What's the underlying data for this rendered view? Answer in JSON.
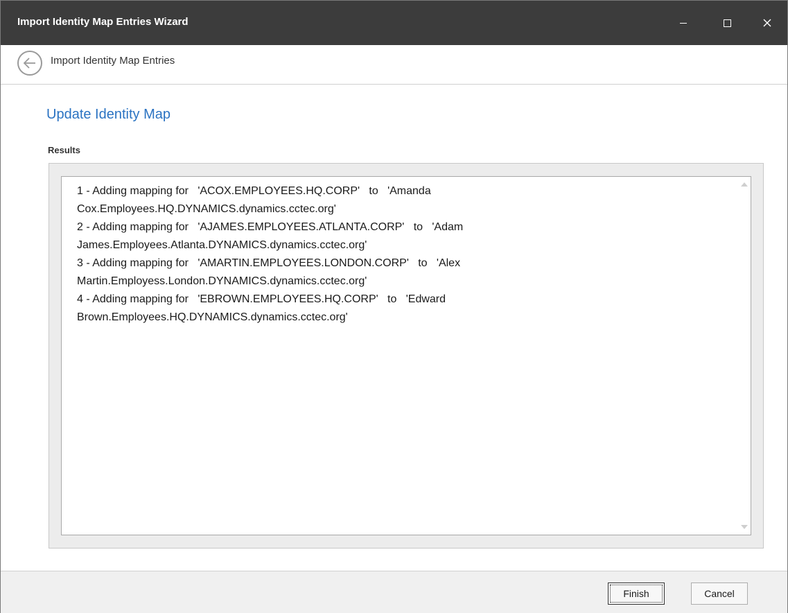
{
  "window": {
    "title": "Import Identity Map Entries Wizard",
    "controls": {
      "minimize_icon": "minimize-icon",
      "maximize_icon": "maximize-icon",
      "close_label": "✕"
    }
  },
  "nav": {
    "back_icon": "back-arrow-icon",
    "title": "Import Identity Map Entries"
  },
  "content": {
    "section_title": "Update Identity Map",
    "results_label": "Results",
    "results_lines": [
      "1 - Adding mapping for   'ACOX.EMPLOYEES.HQ.CORP'   to   'Amanda",
      "Cox.Employees.HQ.DYNAMICS.dynamics.cctec.org'",
      "2 - Adding mapping for   'AJAMES.EMPLOYEES.ATLANTA.CORP'   to   'Adam",
      "James.Employees.Atlanta.DYNAMICS.dynamics.cctec.org'",
      "3 - Adding mapping for   'AMARTIN.EMPLOYEES.LONDON.CORP'   to   'Alex",
      "Martin.Employess.London.DYNAMICS.dynamics.cctec.org'",
      "4 - Adding mapping for   'EBROWN.EMPLOYEES.HQ.CORP'   to   'Edward",
      "Brown.Employees.HQ.DYNAMICS.dynamics.cctec.org'"
    ]
  },
  "footer": {
    "finish_label": "Finish",
    "cancel_label": "Cancel"
  },
  "colors": {
    "titlebar": "#3c3c3c",
    "accent": "#2b73c2",
    "footer": "#f0f0f0"
  }
}
